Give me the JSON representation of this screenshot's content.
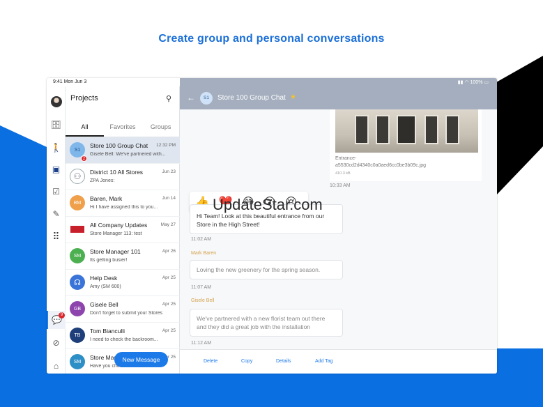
{
  "headline": "Create group and personal conversations",
  "watermark": "UpdateStar.com",
  "status": {
    "time": "9:41 Mon Jun 3",
    "battery": "100%"
  },
  "list": {
    "title": "Projects",
    "tabs": [
      "All",
      "Favorites",
      "Groups"
    ],
    "new_message_label": "New Message",
    "conversations": [
      {
        "initials": "S1",
        "name": "Store 100 Group Chat",
        "time": "12:32 PM",
        "preview": "Gisele Bell: We've partnered with...",
        "badge": "2",
        "color": "#7fb7ea"
      },
      {
        "initials": "",
        "name": "District 10 All Stores",
        "time": "Jun 23",
        "preview": "ZPA Jones:",
        "color": "#ffffff"
      },
      {
        "initials": "BM",
        "name": "Baren, Mark",
        "time": "Jun 14",
        "preview": "Hi I have assigned this to you...",
        "color": "#f0a04b"
      },
      {
        "initials": "",
        "name": "All Company Updates",
        "time": "May 27",
        "preview": "Store Manager 113: test",
        "color": "#ffffff"
      },
      {
        "initials": "SM",
        "name": "Store Manager 101",
        "time": "Apr 26",
        "preview": "Its getting busier!",
        "color": "#4caf50"
      },
      {
        "initials": "",
        "name": "Help Desk",
        "time": "Apr 25",
        "preview": "Amy (SM 600)",
        "color": "#3a74d8"
      },
      {
        "initials": "GB",
        "name": "Gisele Bell",
        "time": "Apr 25",
        "preview": "Don't forget to submit your Stores",
        "color": "#8e44ad"
      },
      {
        "initials": "TB",
        "name": "Tom Bianculli",
        "time": "Apr 25",
        "preview": "I need to check the backroom...",
        "color": "#1e3f7a"
      },
      {
        "initials": "SM",
        "name": "Store Manager",
        "time": "Apr 25",
        "preview": "Have you checked in with...",
        "color": "#2e8fc7"
      }
    ]
  },
  "rail": {
    "chat_badge": "9"
  },
  "chat": {
    "avatar": "S1",
    "title": "Store 100 Group Chat",
    "image_name": "Entrance-a5530cd2d4340c0a0aed6cc0be3b09c.jpg",
    "image_size": "410.3 kB",
    "image_time": "10:33 AM",
    "reactions": [
      "👍",
      "❤️",
      "😄",
      "😮",
      "😢"
    ],
    "messages": [
      {
        "sender": "",
        "text": "Hi Team! Look at this beautiful entrance from our Store in the High Street!",
        "time": "11:02 AM"
      },
      {
        "sender": "Mark Baren",
        "text": "Loving the new greenery for the spring season.",
        "time": "11:07 AM"
      },
      {
        "sender": "Gisele Bell",
        "text": "We've partnered with a new florist team out there and they did a great job with the installation",
        "time": "11:12 AM"
      }
    ],
    "actions": [
      "Delete",
      "Copy",
      "Details",
      "Add Tag"
    ]
  }
}
